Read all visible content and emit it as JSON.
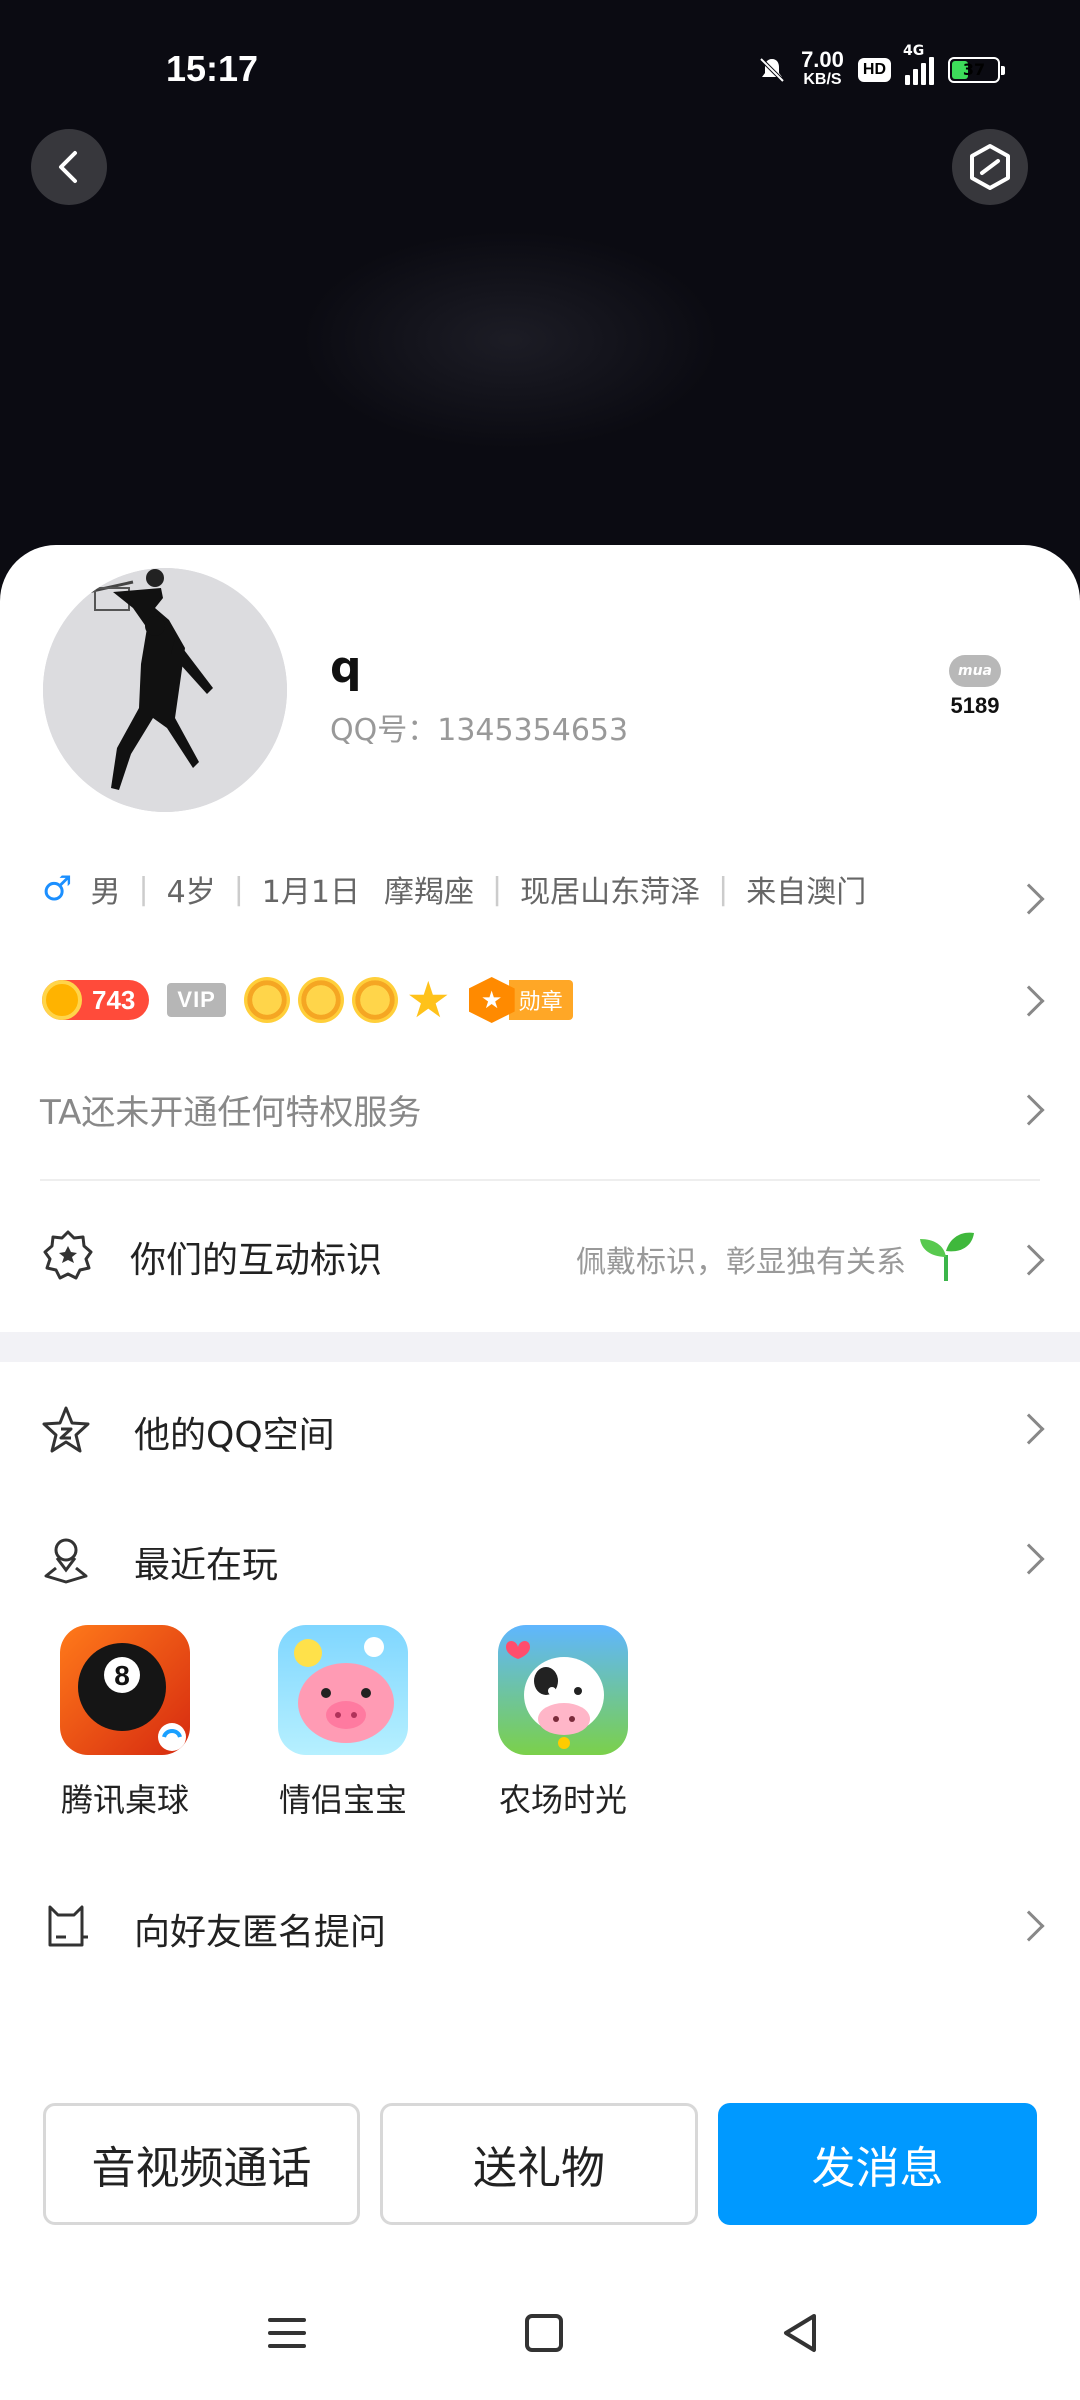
{
  "status_bar": {
    "time": "15:17",
    "speed_value": "7.00",
    "speed_unit": "KB/S",
    "hd": "HD",
    "network": "4G",
    "battery": "37"
  },
  "profile": {
    "nickname": "q",
    "qq_number": "QQ号：1345354653",
    "mua_count": "5189",
    "mua_label": "mua"
  },
  "info": {
    "gender": "男",
    "age": "4岁",
    "birthday": "1月1日",
    "zodiac": "摩羯座",
    "residence": "现居山东菏泽",
    "hometown": "来自澳门"
  },
  "badges": {
    "coins": "743",
    "vip": "VIP",
    "medal": "勋章"
  },
  "privilege_text": "TA还未开通任何特权服务",
  "interaction": {
    "label": "你们的互动标识",
    "hint": "佩戴标识，彰显独有关系"
  },
  "menu": {
    "qzone": "他的QQ空间",
    "recent_play": "最近在玩",
    "anonymous_question": "向好友匿名提问"
  },
  "games": [
    {
      "name": "腾讯桌球"
    },
    {
      "name": "情侣宝宝"
    },
    {
      "name": "农场时光"
    }
  ],
  "actions": {
    "call": "音视频通话",
    "gift": "送礼物",
    "message": "发消息"
  },
  "colors": {
    "accent": "#0099ff",
    "coin": "#ff4b3a",
    "male": "#1b8fff"
  }
}
